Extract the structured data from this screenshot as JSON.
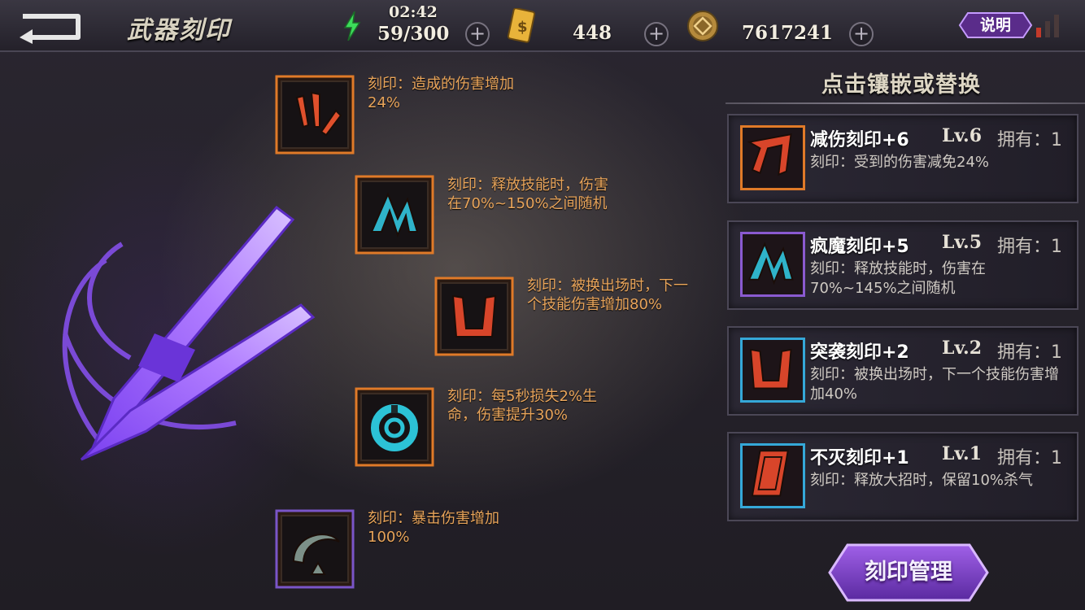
{
  "header": {
    "title": "武器刻印",
    "time": "02:42",
    "energy": "59/300",
    "tickets": "448",
    "coins": "7617241",
    "help_label": "说明"
  },
  "slots": [
    {
      "text": "刻印：造成的伤害增加24%",
      "color": "#e0502c",
      "frame": "orange",
      "icon": "claw-rune-icon"
    },
    {
      "text": "刻印：释放技能时，伤害在70%~150%之间随机",
      "color": "#2fb3c9",
      "frame": "orange",
      "icon": "zigzag-rune-icon"
    },
    {
      "text": "刻印：被换出场时，下一个技能伤害增加80%",
      "color": "#d8452a",
      "frame": "orange",
      "icon": "horn-rune-icon"
    },
    {
      "text": "刻印：每5秒损失2%生命，伤害提升30%",
      "color": "#2cc2d6",
      "frame": "orange",
      "icon": "ring-rune-icon"
    },
    {
      "text": "刻印：暴击伤害增加100%",
      "color": "#7c9088",
      "frame": "purple",
      "icon": "crescent-rune-icon"
    }
  ],
  "panel": {
    "title": "点击镶嵌或替换",
    "cards": [
      {
        "name": "减伤刻印+6",
        "level": "Lv.6",
        "own": "拥有：1",
        "desc": "刻印：受到的伤害减免24%",
        "color": "#d8452a",
        "frame": "#e07a28",
        "icon": "shield-rune-icon"
      },
      {
        "name": "疯魔刻印+5",
        "level": "Lv.5",
        "own": "拥有：1",
        "desc": "刻印：释放技能时，伤害在70%~145%之间随机",
        "color": "#2fb3c9",
        "frame": "#8a5ad0",
        "icon": "zigzag-rune-icon"
      },
      {
        "name": "突袭刻印+2",
        "level": "Lv.2",
        "own": "拥有：1",
        "desc": "刻印：被换出场时，下一个技能伤害增加40%",
        "color": "#d8452a",
        "frame": "#35a8d8",
        "icon": "horn-rune-icon"
      },
      {
        "name": "不灭刻印+1",
        "level": "Lv.1",
        "own": "拥有：1",
        "desc": "刻印：释放大招时，保留10%杀气",
        "color": "#d8452a",
        "frame": "#35a8d8",
        "icon": "card-rune-icon"
      }
    ]
  },
  "manage_label": "刻印管理"
}
